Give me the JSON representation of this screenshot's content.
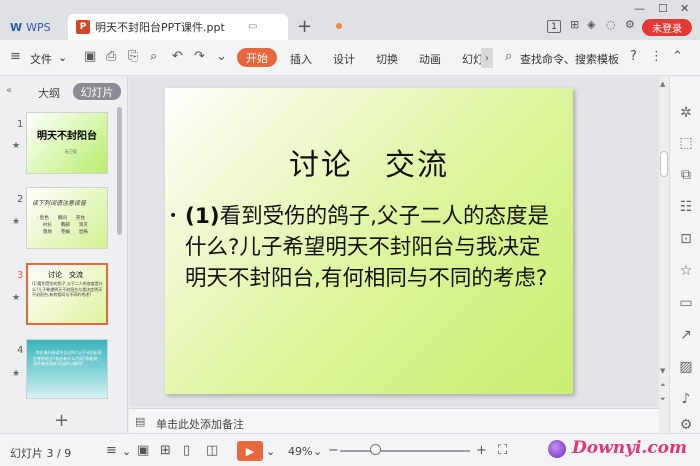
{
  "app": {
    "home_tab": "WPS",
    "doc_tab": "明天不封阳台PPT课件.ppt",
    "doc_badge": "P",
    "login_button": "未登录",
    "page_count_badge": "1",
    "brand_color": "#e8683d"
  },
  "ribbon": {
    "file_menu": "文件",
    "tabs": [
      "开始",
      "插入",
      "设计",
      "切换",
      "动画",
      "幻灯"
    ],
    "active_tab": "开始",
    "search_label": "查找命令、搜索模板",
    "help": "?"
  },
  "left_panel": {
    "tab_outline": "大纲",
    "tab_slides": "幻灯片",
    "slides": [
      {
        "num": "1",
        "title": "明天不封阳台",
        "subtitle": "阮卫家"
      },
      {
        "num": "2",
        "title": "读下列词语注意读音",
        "rows": [
          "· 脸色　　瞬间　　夹住",
          "　 衬衫　　胸部　　消灭",
          "　 落地　　苍蝇　　恐怖"
        ]
      },
      {
        "num": "3",
        "title": "讨论　交流",
        "body": "(1)看到受伤的鸽子,父子二人的态度是什么?儿子希望明天不封阳台与我决定明天不封阳台,有何相同与不同的考虑?"
      },
      {
        "num": "4",
        "body": "· 你在课外阅读中见过吗?父子分别出现在哪些地方?各自有什么不同?你能说一说作者在两处写出的心情吗?"
      }
    ],
    "selected_slide": 3,
    "add_label": "+"
  },
  "slide": {
    "title": "讨论　交流",
    "bullet": "•",
    "body_bold": "(1)",
    "body": "看到受伤的鸽子,父子二人的态度是什么?儿子希望明天不封阳台与我决定明天不封阳台,有何相同与不同的考虑?"
  },
  "notes": {
    "placeholder": "单击此处添加备注"
  },
  "status": {
    "slide_counter": "幻灯片 3 / 9",
    "zoom": "49%",
    "zoom_level": 0.49,
    "watermark": "Downyi.com"
  }
}
